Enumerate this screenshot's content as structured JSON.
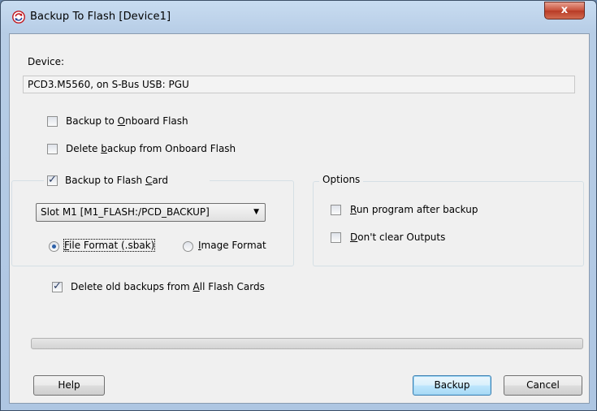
{
  "window": {
    "title": "Backup To Flash [Device1]",
    "close_glyph": "x",
    "icon": "saia-refresh-icon"
  },
  "device": {
    "label": "Device:",
    "value": "PCD3.M5560, on S-Bus USB: PGU"
  },
  "onboard": {
    "backup_label_pre": "Backup to ",
    "backup_label_u": "O",
    "backup_label_post": "nboard Flash",
    "backup_checked": false,
    "delete_label_pre": "Delete ",
    "delete_label_u": "b",
    "delete_label_post": "ackup from Onboard Flash",
    "delete_checked": false
  },
  "flash_card": {
    "group_label_pre": "Backup to Flash ",
    "group_label_u": "C",
    "group_label_post": "ard",
    "checked": true,
    "slot_selected": "Slot M1 [M1_FLASH:/PCD_BACKUP]",
    "format_file_u": "F",
    "format_file_post": "ile Format (.sbak)",
    "format_file_selected": true,
    "format_image_u": "I",
    "format_image_post": "mage Format",
    "format_image_selected": false
  },
  "options": {
    "group_label": "Options",
    "run_u": "R",
    "run_post": "un program after backup",
    "run_checked": false,
    "dont_u": "D",
    "dont_post": "on't clear Outputs",
    "dont_checked": false
  },
  "delete_old": {
    "label_pre": "Delete old backups from ",
    "label_u": "A",
    "label_post": "ll Flash Cards",
    "checked": true
  },
  "progress": {
    "value": 0
  },
  "buttons": {
    "help": "Help",
    "backup": "Backup",
    "cancel": "Cancel"
  },
  "colors": {
    "accent": "#2c5fa8",
    "close": "#c7503a",
    "frame": "#b7cde6"
  }
}
